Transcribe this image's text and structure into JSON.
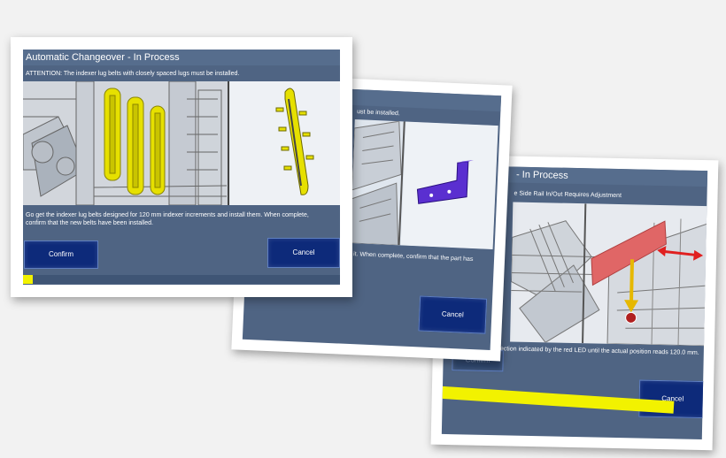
{
  "screens": {
    "front": {
      "title": "Automatic Changeover - In Process",
      "attention": "ATTENTION: The indexer lug belts with closely spaced lugs must be installed.",
      "instruction_line1": "Go get the indexer lug belts designed for 120 mm indexer increments and install them.  When complete,",
      "instruction_line2": "confirm that the new belts have been installed.",
      "confirm_label": "Confirm",
      "cancel_label": "Cancel",
      "progress": 0.03
    },
    "middle": {
      "attention_fragment": "ust be installed.",
      "instruction_line1": "all it.  When complete, confirm that the part has",
      "instruction_line2": "",
      "cancel_label": "Cancel"
    },
    "back": {
      "title_fragment": "- In Process",
      "attention_fragment": "e Side Rail In/Out Requires Adjustment",
      "instruction": "ection indicated by the red LED until the actual position reads 120.0 mm.",
      "confirm_label": "Confirm",
      "cancel_label": "Cancel",
      "progress": 0.9
    }
  },
  "colors": {
    "panel": "#4f6483",
    "button": "#0d2a7a",
    "progress": "#f2f200",
    "lug_belt": "#e6e000",
    "bracket": "#5a2fd0",
    "side_rail": "#e06666"
  },
  "icons": {
    "double_arrow": "double-arrow-icon",
    "down_arrow": "down-arrow-icon"
  }
}
